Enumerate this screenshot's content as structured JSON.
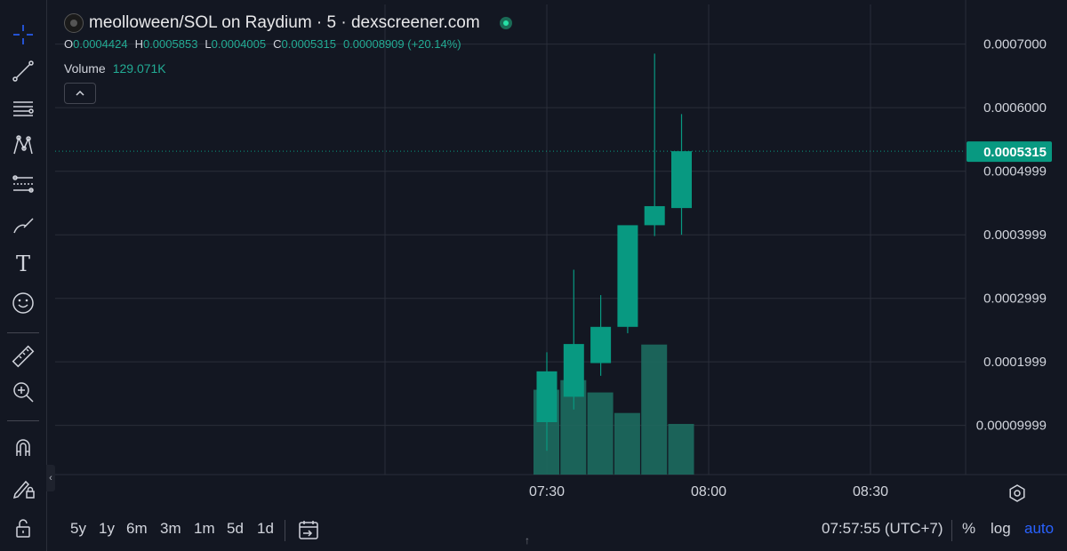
{
  "legend": {
    "title": "meolloween/SOL on Raydium · 5 · dexscreener.com",
    "open_key": "O",
    "open": "0.0004424",
    "high_key": "H",
    "high": "0.0005853",
    "low_key": "L",
    "low": "0.0004005",
    "close_key": "C",
    "close": "0.0005315",
    "change": "0.00008909 (+20.14%)",
    "volume_key": "Volume",
    "volume": "129.071K",
    "toggle_glyph": "^"
  },
  "colors": {
    "up": "#089981",
    "up_bright": "#26a69a",
    "volume": "#1d6b5f",
    "background": "#131722",
    "grid": "#2a2e39",
    "axis_text": "#d1d4dc",
    "price_tag": "#089981",
    "range_active": "#2962ff"
  },
  "chart_data": {
    "type": "candlestick",
    "x_ticks": [
      "07:30",
      "08:00",
      "08:30"
    ],
    "y_ticks": [
      "0.0007000",
      "0.0006000",
      "0.0004999",
      "0.0003999",
      "0.0002999",
      "0.0001999",
      "0.00009999"
    ],
    "y_tick_values": [
      0.0007,
      0.0006,
      0.0004999,
      0.0003999,
      0.0002999,
      0.0001999,
      9.999e-05
    ],
    "ylim": [
      2.25e-05,
      0.0007625
    ],
    "current_price": "0.0005315",
    "current_price_value": 0.0005315,
    "candles": [
      {
        "time": "07:30",
        "open": 0.000105,
        "high": 0.000215,
        "low": 6e-05,
        "close": 0.000185
      },
      {
        "time": "07:35",
        "open": 0.000145,
        "high": 0.000345,
        "low": 0.000125,
        "close": 0.000228
      },
      {
        "time": "07:40",
        "open": 0.000198,
        "high": 0.000305,
        "low": 0.000178,
        "close": 0.000255
      },
      {
        "time": "07:45",
        "open": 0.000255,
        "high": 0.000385,
        "low": 0.000245,
        "close": 0.000415
      },
      {
        "time": "07:50",
        "open": 0.000415,
        "high": 0.000685,
        "low": 0.000398,
        "close": 0.000445
      },
      {
        "time": "07:55",
        "open": 0.000442,
        "high": 0.00059,
        "low": 0.0004,
        "close": 0.0005315
      }
    ],
    "volume": [
      0.62,
      0.69,
      0.6,
      0.45,
      0.95,
      0.37
    ]
  },
  "toolbar": {
    "tools": [
      "crosshair-icon",
      "trend-line-icon",
      "horizontal-lines-icon",
      "pattern-icon",
      "fib-icon",
      "brush-icon",
      "text-icon",
      "emoji-icon",
      "ruler-icon",
      "zoom-in-icon",
      "magnet-icon",
      "lock-drawing-icon",
      "unlock-icon"
    ],
    "text_tool_glyph": "T"
  },
  "bottom": {
    "ranges": [
      "5y",
      "1y",
      "6m",
      "3m",
      "1m",
      "5d",
      "1d"
    ],
    "clock": "07:57:55 (UTC+7)",
    "percent": "%",
    "log": "log",
    "auto": "auto",
    "collapse_glyph": "‹",
    "scroll_glyph": "↑"
  }
}
